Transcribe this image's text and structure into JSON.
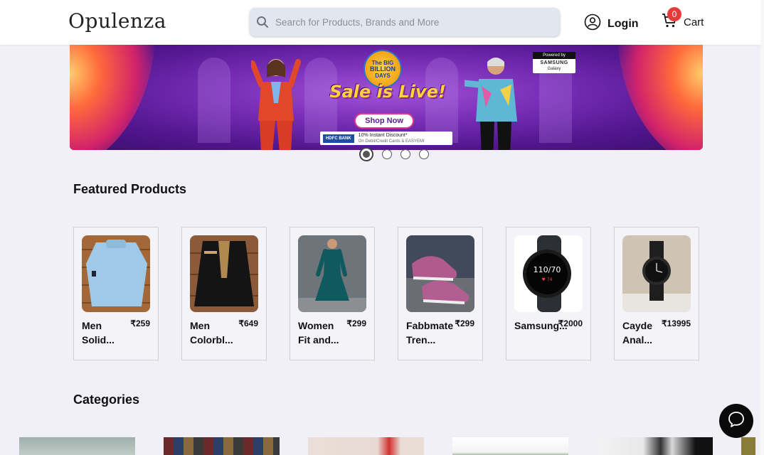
{
  "header": {
    "logo": "Opulenza",
    "search_placeholder": "Search for Products, Brands and More",
    "login_label": "Login",
    "cart_label": "Cart",
    "cart_count": "0"
  },
  "banner": {
    "big_billion": [
      "The BIG",
      "BILLION",
      "DAYS"
    ],
    "title": "Sale is Live!",
    "shop_now": "Shop Now",
    "bank": "HDFC BANK",
    "offer_line1": "10% Instant Discount*",
    "offer_line2": "On Debit/Credit Cards & EASYEMI",
    "powered_by": "Powered by",
    "sponsor": "SAMSUNG",
    "sponsor_sub": "Galaxy",
    "slide_count": 4,
    "active_slide": 1
  },
  "featured": {
    "title": "Featured Products",
    "products": [
      {
        "name": "Men Solid...",
        "price": "₹259",
        "image": "light-blue-sweater"
      },
      {
        "name": "Men Colorbl...",
        "price": "₹649",
        "image": "black-jacket"
      },
      {
        "name": "Women Fit and...",
        "price": "₹299",
        "image": "teal-dress"
      },
      {
        "name": "Fabbmate Tren...",
        "price": "₹299",
        "image": "pink-sneakers"
      },
      {
        "name": "Samsung...",
        "price": "₹2000",
        "image": "smartwatch"
      },
      {
        "name": "Cayde Anal...",
        "price": "₹13995",
        "image": "analog-watch"
      }
    ]
  },
  "categories": {
    "title": "Categories"
  },
  "colors": {
    "accent": "#e53b3b",
    "page_bg": "#f1f0f7",
    "search_bg": "#e2e7ef"
  }
}
